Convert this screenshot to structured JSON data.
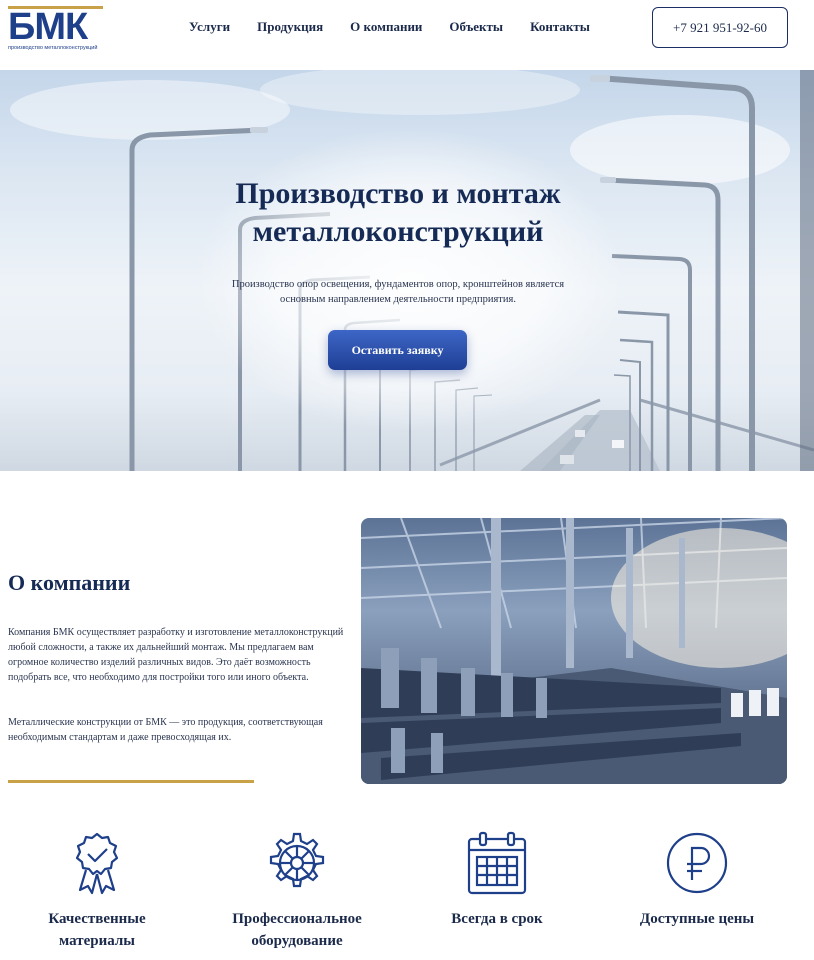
{
  "header": {
    "logo_text": "БМК",
    "logo_sub": "производство металлоконструкций",
    "nav": [
      "Услуги",
      "Продукция",
      "О компании",
      "Объекты",
      "Контакты"
    ],
    "phone": "+7 921 951-92-60"
  },
  "hero": {
    "title_line1": "Производство и монтаж",
    "title_line2": "металлоконструкций",
    "text": "Производство опор освещения, фундаментов опор, кронштейнов является основным направлением деятельности предприятия.",
    "cta": "Оставить заявку"
  },
  "about": {
    "title": "О компании",
    "p1": "Компания БМК осуществляет разработку и изготовление металлоконструкций любой сложности, а также их дальнейший монтаж. Мы предлагаем вам огромное количество изделий различных видов. Это даёт возможность подобрать все, что необходимо для постройки того или иного объекта.",
    "p2": "Металлические конструкции от БМК — это продукция, соответствующая необходимым стандартам и даже превосходящая их."
  },
  "features": [
    {
      "icon": "quality-badge-icon",
      "line1": "Качественные",
      "line2": "материалы"
    },
    {
      "icon": "gear-icon",
      "line1": "Профессиональное",
      "line2": "оборудование"
    },
    {
      "icon": "calendar-icon",
      "line1": "Всегда в срок",
      "line2": ""
    },
    {
      "icon": "ruble-icon",
      "line1": "Доступные цены",
      "line2": ""
    }
  ],
  "colors": {
    "brand_blue": "#1e3f8a",
    "gold": "#c9a248",
    "dark_text": "#152a55"
  }
}
